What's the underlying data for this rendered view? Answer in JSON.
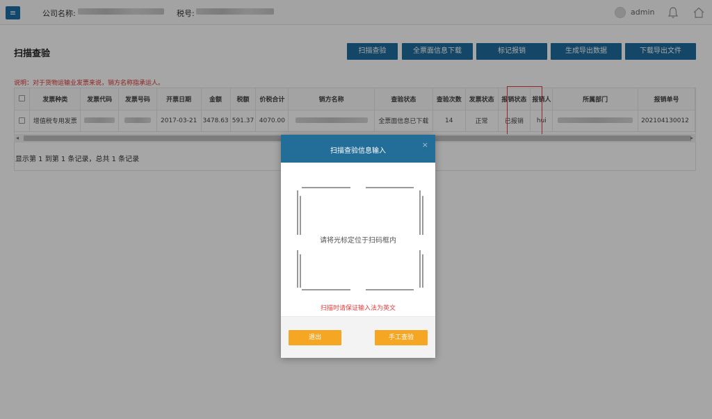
{
  "header": {
    "menu_icon": "hamburger-icon",
    "company_label": "公司名称:",
    "tax_label": "税号:",
    "user_name": "admin",
    "bell_icon": "bell-icon",
    "home_icon": "home-icon"
  },
  "page": {
    "title": "扫描查验",
    "note": "说明：对于货物运输业发票来说，销方名称指承运人。"
  },
  "toolbar": {
    "buttons": [
      "扫描查验",
      "全票面信息下载",
      "标记报销",
      "生成导出数据",
      "下载导出文件"
    ]
  },
  "table": {
    "headers": [
      "发票种类",
      "发票代码",
      "发票号码",
      "开票日期",
      "金额",
      "税额",
      "价税合计",
      "销方名称",
      "查验状态",
      "查验次数",
      "发票状态",
      "报销状态",
      "报销人",
      "所属部门",
      "报销单号"
    ],
    "row": {
      "type": "增值税专用发票",
      "date": "2017-03-21",
      "amount": "3478.63",
      "tax": "591.37",
      "total": "4070.00",
      "check_status": "全票面信息已下载",
      "check_count": "14",
      "invoice_status": "正常",
      "reimburse_status": "已报销",
      "reimburser": "hui",
      "bill_no": "202104130012"
    }
  },
  "pagination": {
    "summary": "显示第 1 到第 1 条记录，总共 1 条记录"
  },
  "modal": {
    "title": "扫描查验信息输入",
    "close": "×",
    "instruction": "请将光标定位于扫码框内",
    "warning": "扫描时请保证输入法为英文",
    "exit_label": "退出",
    "manual_label": "手工查验"
  },
  "colors": {
    "primary": "#1f6e9e",
    "modal_header": "#236d99",
    "accent_orange": "#f5a623",
    "warning_red": "#e03b3b"
  }
}
